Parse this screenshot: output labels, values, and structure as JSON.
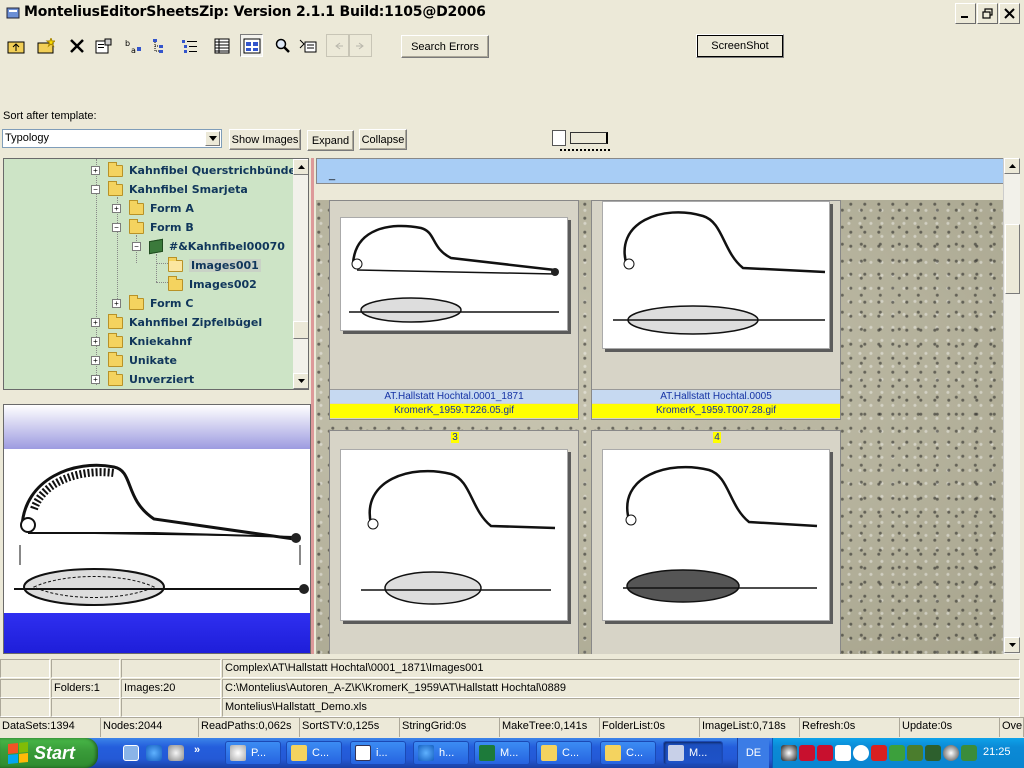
{
  "window": {
    "title": "MonteliusEditorSheetsZip: Version  2.1.1 Build:1105@D2006"
  },
  "toolbar": {
    "icons": [
      "up-folder-icon",
      "new-folder-icon",
      "delete-icon",
      "properties-icon",
      "sort-ab-icon",
      "tree-view-icon",
      "list-tree-icon",
      "details-icon",
      "thumbnails-icon",
      "find-icon",
      "find-next-icon",
      "back-icon",
      "forward-icon"
    ],
    "search_errors_label": "Search Errors",
    "screenshot_label": "ScreenShot"
  },
  "sort": {
    "label": "Sort after template:",
    "selected": "Typology",
    "show_images_label": "Show Images",
    "expand_label": "Expand",
    "collapse_label": "Collapse"
  },
  "tree": {
    "items": [
      {
        "label": "Kahnfibel Querstrichbünde...",
        "level": 0,
        "expander": "+",
        "icon": "folder-icon"
      },
      {
        "label": "Kahnfibel Smarjeta",
        "level": 0,
        "expander": "−",
        "icon": "folder-icon"
      },
      {
        "label": "Form A",
        "level": 1,
        "expander": "+",
        "icon": "folder-icon"
      },
      {
        "label": "Form B",
        "level": 1,
        "expander": "−",
        "icon": "folder-icon"
      },
      {
        "label": "#&Kahnfibel00070",
        "level": 2,
        "expander": "−",
        "icon": "book-icon"
      },
      {
        "label": "Images001",
        "level": 3,
        "expander": "",
        "icon": "folder-open-icon",
        "selected": true
      },
      {
        "label": "Images002",
        "level": 3,
        "expander": "",
        "icon": "folder-icon"
      },
      {
        "label": "Form C",
        "level": 1,
        "expander": "+",
        "icon": "folder-icon"
      },
      {
        "label": "Kahnfibel Zipfelbügel",
        "level": 0,
        "expander": "+",
        "icon": "folder-icon"
      },
      {
        "label": "Kniekahnf",
        "level": 0,
        "expander": "+",
        "icon": "folder-icon"
      },
      {
        "label": "Unikate",
        "level": 0,
        "expander": "+",
        "icon": "folder-icon"
      },
      {
        "label": "Unverziert",
        "level": 0,
        "expander": "+",
        "icon": "folder-icon"
      }
    ]
  },
  "gallery": {
    "header_text": "_",
    "cards": [
      {
        "number": "",
        "site": "AT.Hallstatt Hochtal.0001_1871",
        "file": "KromerK_1959.T226.05.gif"
      },
      {
        "number": "",
        "site": "AT.Hallstatt Hochtal.0005",
        "file": "KromerK_1959.T007.28.gif"
      },
      {
        "number": "3",
        "site": "",
        "file": ""
      },
      {
        "number": "4",
        "site": "",
        "file": ""
      }
    ]
  },
  "status": {
    "row1": {
      "path": "Complex\\AT\\Hallstatt Hochtal\\0001_1871\\Images001"
    },
    "row2": {
      "folders": "Folders:1",
      "images": "Images:20",
      "path": "C:\\Montelius\\Autoren_A-Z\\K\\KromerK_1959\\AT\\Hallstatt Hochtal\\0889"
    },
    "row3": {
      "path": "Montelius\\Hallstatt_Demo.xls"
    },
    "stats": [
      "DataSets:1394",
      "Nodes:2044",
      "ReadPaths:0,062s",
      "SortSTV:0,125s",
      "StringGrid:0s",
      "MakeTree:0,141s",
      "FolderList:0s",
      "ImageList:0,718s",
      "Refresh:0s",
      "Update:0s",
      "Ove"
    ]
  },
  "taskbar": {
    "start_label": "Start",
    "tasks": [
      {
        "label": "P...",
        "icon": "paint-icon"
      },
      {
        "label": "C...",
        "icon": "folder-icon"
      },
      {
        "label": "i...",
        "icon": "word-icon"
      },
      {
        "label": "h...",
        "icon": "ie-icon"
      },
      {
        "label": "M...",
        "icon": "excel-icon"
      },
      {
        "label": "C...",
        "icon": "folder-icon"
      },
      {
        "label": "C...",
        "icon": "folder-icon"
      },
      {
        "label": "M...",
        "icon": "app-icon",
        "active": true
      }
    ],
    "language": "DE",
    "clock": "21:25"
  }
}
